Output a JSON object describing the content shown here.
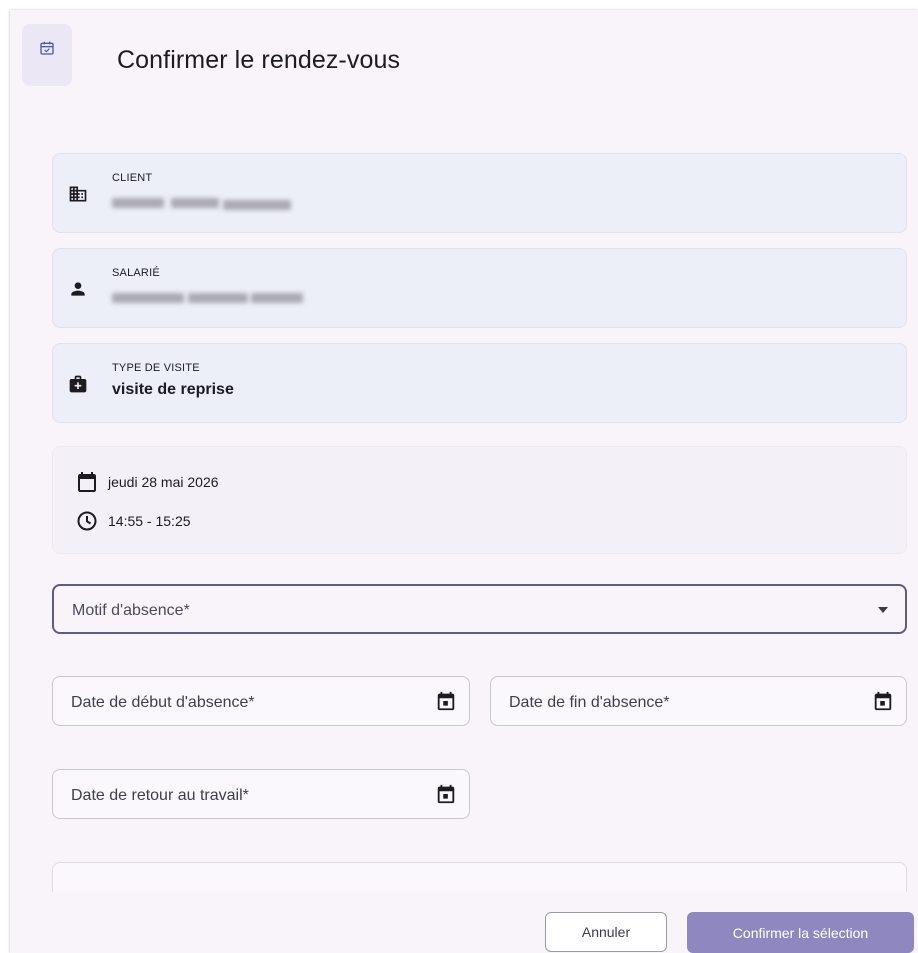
{
  "dialog": {
    "title": "Confirmer le rendez-vous",
    "header_icon": "calendar-check-icon"
  },
  "client": {
    "label": "CLIENT",
    "icon": "building-icon",
    "value_redacted": true
  },
  "employee": {
    "label": "SALARIÉ",
    "icon": "person-icon",
    "value_redacted": true
  },
  "visit_type": {
    "label": "TYPE DE VISITE",
    "icon": "medical-bag-icon",
    "value": "visite de reprise"
  },
  "appointment": {
    "date": "jeudi 28 mai 2026",
    "date_icon": "calendar-icon",
    "time": "14:55 - 15:25",
    "time_icon": "clock-icon"
  },
  "form": {
    "absence_reason": {
      "placeholder": "Motif d'absence*",
      "icon": "caret-down-icon"
    },
    "absence_start": {
      "placeholder": "Date de début d'absence*",
      "icon": "calendar-icon"
    },
    "absence_end": {
      "placeholder": "Date de fin d'absence*",
      "icon": "calendar-icon"
    },
    "return_to_work": {
      "placeholder": "Date de retour au travail*",
      "icon": "calendar-icon"
    }
  },
  "actions": {
    "cancel_label": "Annuler",
    "confirm_label": "Confirmer la sélection"
  },
  "colors": {
    "accent": "#8e87c0",
    "focus_border": "#5e5a86",
    "card_bg": "#eceef8",
    "dialog_bg": "#f8f4fa"
  }
}
